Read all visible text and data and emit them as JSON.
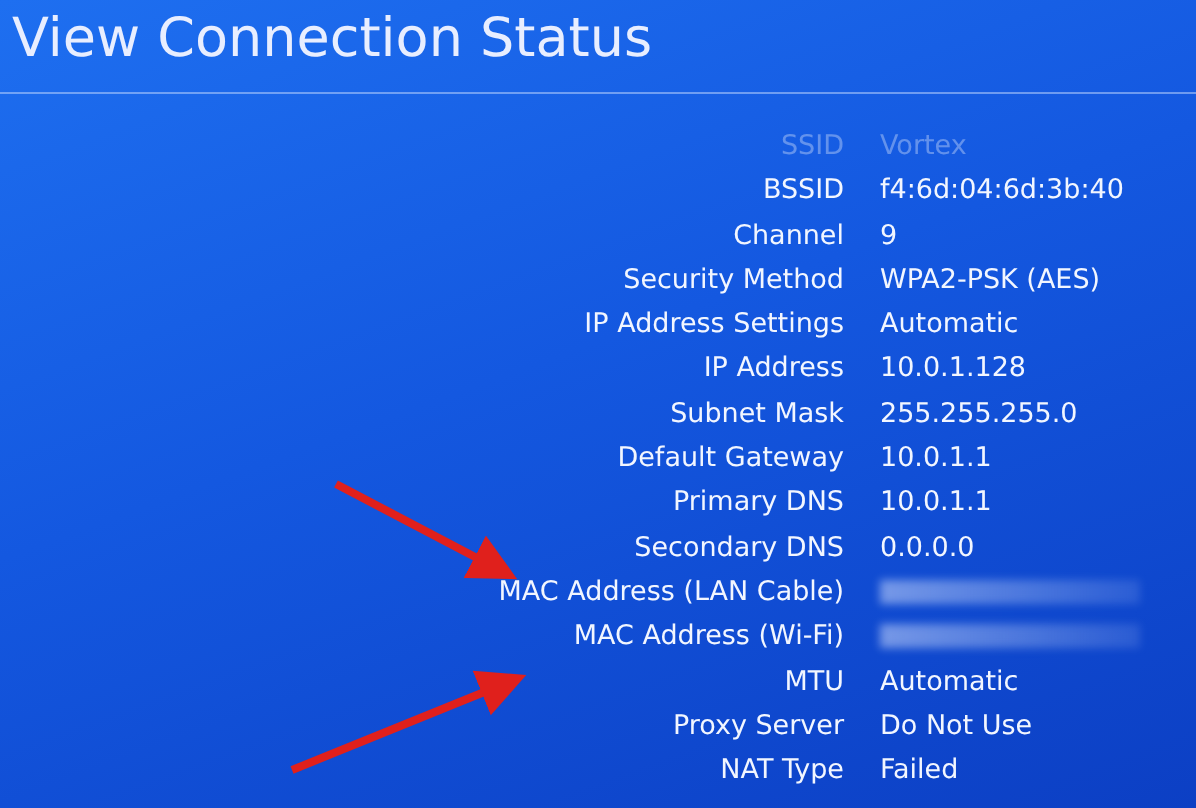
{
  "title": "View Connection Status",
  "rows": [
    {
      "label": "SSID",
      "value": "Vortex",
      "kind": "faded"
    },
    {
      "label": "BSSID",
      "value": "f4:6d:04:6d:3b:40",
      "kind": "text"
    },
    {
      "label": "Channel",
      "value": "9",
      "kind": "text"
    },
    {
      "label": "Security Method",
      "value": "WPA2-PSK (AES)",
      "kind": "text"
    },
    {
      "label": "IP Address Settings",
      "value": "Automatic",
      "kind": "text"
    },
    {
      "label": "IP Address",
      "value": "10.0.1.128",
      "kind": "text"
    },
    {
      "label": "Subnet Mask",
      "value": "255.255.255.0",
      "kind": "text"
    },
    {
      "label": "Default Gateway",
      "value": "10.0.1.1",
      "kind": "text"
    },
    {
      "label": "Primary DNS",
      "value": "10.0.1.1",
      "kind": "text"
    },
    {
      "label": "Secondary DNS",
      "value": "0.0.0.0",
      "kind": "text"
    },
    {
      "label": "MAC Address (LAN Cable)",
      "kind": "blurred"
    },
    {
      "label": "MAC Address (Wi-Fi)",
      "kind": "blurred"
    },
    {
      "label": "MTU",
      "value": "Automatic",
      "kind": "text"
    },
    {
      "label": "Proxy Server",
      "value": "Do Not Use",
      "kind": "text"
    },
    {
      "label": "NAT Type",
      "value": "Failed",
      "kind": "text"
    }
  ]
}
